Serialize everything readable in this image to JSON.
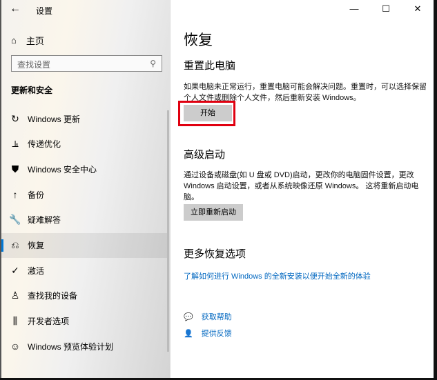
{
  "app_title": "设置",
  "sidebar": {
    "home": "主页",
    "search_placeholder": "查找设置",
    "section": "更新和安全",
    "items": [
      {
        "label": "Windows 更新",
        "icon": "↻"
      },
      {
        "label": "传递优化",
        "icon": "⫡"
      },
      {
        "label": "Windows 安全中心",
        "icon": "⛊"
      },
      {
        "label": "备份",
        "icon": "↑"
      },
      {
        "label": "疑难解答",
        "icon": "🔧"
      },
      {
        "label": "恢复",
        "icon": "⎌",
        "selected": true
      },
      {
        "label": "激活",
        "icon": "✓"
      },
      {
        "label": "查找我的设备",
        "icon": "♙"
      },
      {
        "label": "开发者选项",
        "icon": "⫼"
      },
      {
        "label": "Windows 预览体验计划",
        "icon": "☺"
      }
    ]
  },
  "main": {
    "title": "恢复",
    "reset": {
      "heading": "重置此电脑",
      "desc": "如果电脑未正常运行，重置电脑可能会解决问题。重置时，可以选择保留个人文件或删除个人文件，然后重新安装 Windows。",
      "button": "开始"
    },
    "advanced": {
      "heading": "高级启动",
      "desc": "通过设备或磁盘(如 U 盘或 DVD)启动，更改你的电脑固件设置，更改 Windows 启动设置，或者从系统映像还原 Windows。 这将重新启动电脑。",
      "button": "立即重新启动"
    },
    "more": {
      "heading": "更多恢复选项",
      "link": "了解如何进行 Windows 的全新安装以便开始全新的体验"
    },
    "help": "获取帮助",
    "feedback": "提供反馈"
  },
  "colors": {
    "accent": "#0078d7",
    "link": "#0067c0",
    "highlight": "#e00010"
  }
}
